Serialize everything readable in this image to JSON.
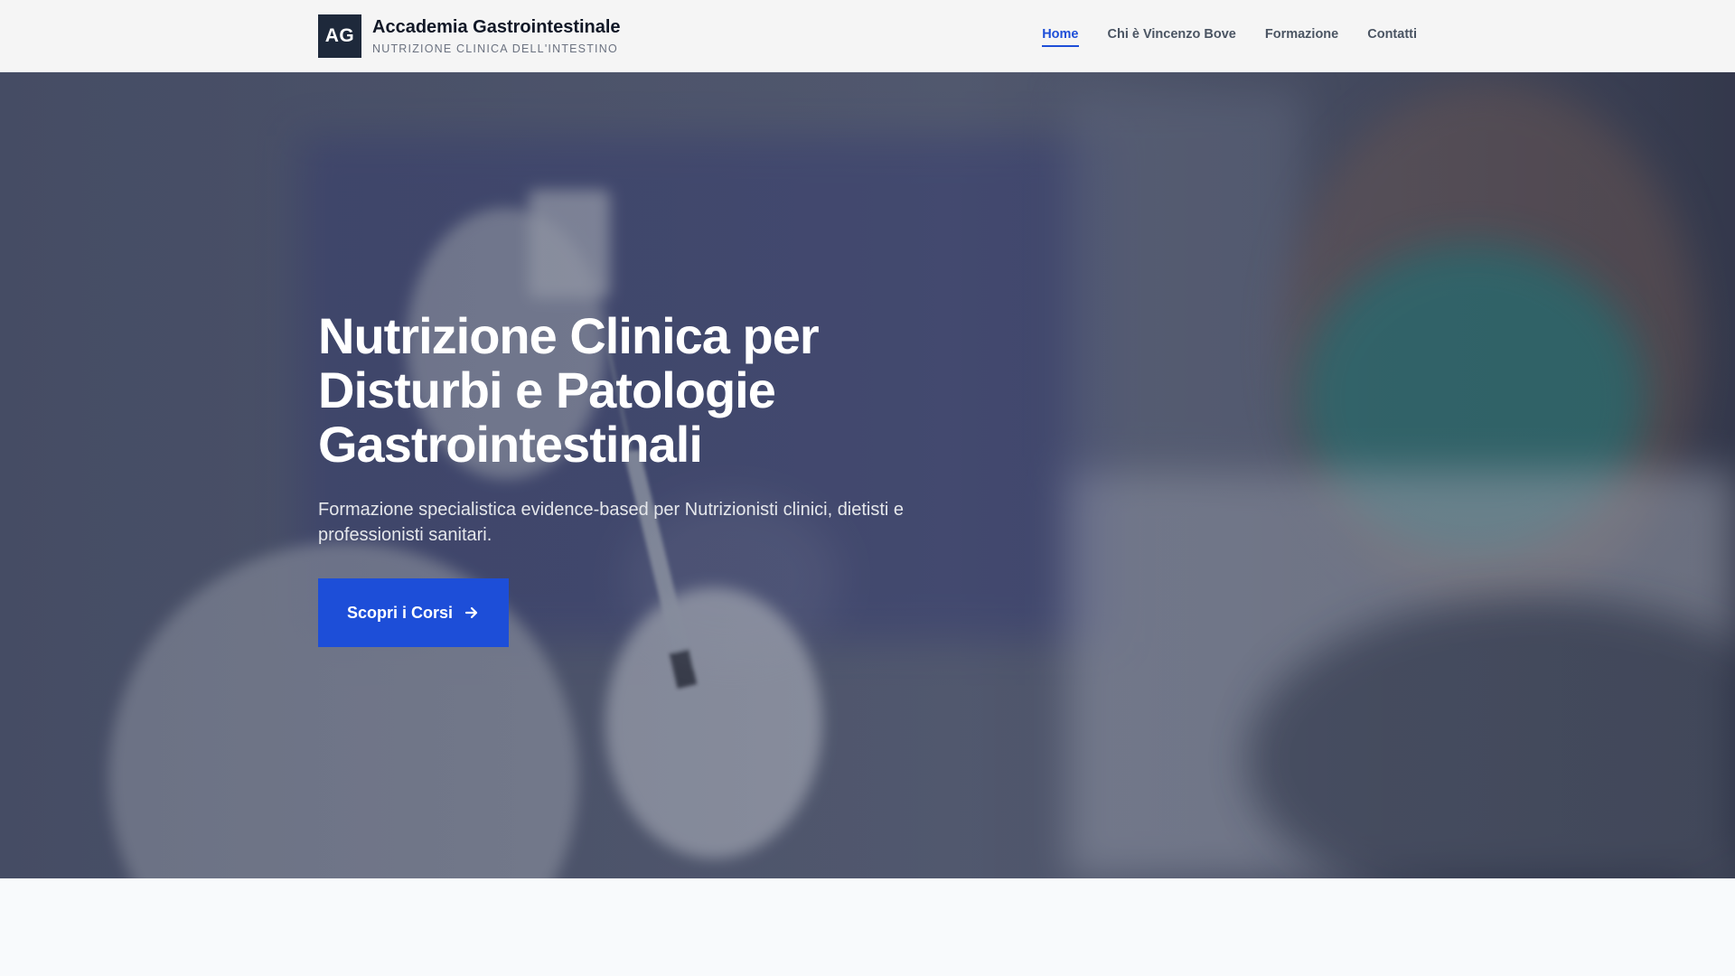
{
  "header": {
    "logo_initials": "AG",
    "brand_name": "Accademia Gastrointestinale",
    "tagline": "NUTRIZIONE CLINICA DELL'INTESTINO",
    "nav": [
      {
        "label": "Home",
        "active": true
      },
      {
        "label": "Chi è Vincenzo Bove",
        "active": false
      },
      {
        "label": "Formazione",
        "active": false
      },
      {
        "label": "Contatti",
        "active": false
      }
    ]
  },
  "hero": {
    "title_line1": "Nutrizione Clinica per",
    "title_line2": "Disturbi e Patologie",
    "title_line3": "Gastrointestinali",
    "subtitle": "Formazione specialistica evidence-based per Nutrizionisti clinici, dietisti e professionisti sanitari.",
    "cta_label": "Scopri i Corsi",
    "cta_icon": "arrow-right-icon",
    "background_image": "gloved hands drawing vaccine from vial with syringe, medical staff in teal mask in background"
  },
  "colors": {
    "accent": "#1d4ed8",
    "logo_bg": "#1e293b",
    "header_bg": "#f5f5f5",
    "page_bg": "#f8fafc",
    "hero_overlay": "#474d63"
  }
}
